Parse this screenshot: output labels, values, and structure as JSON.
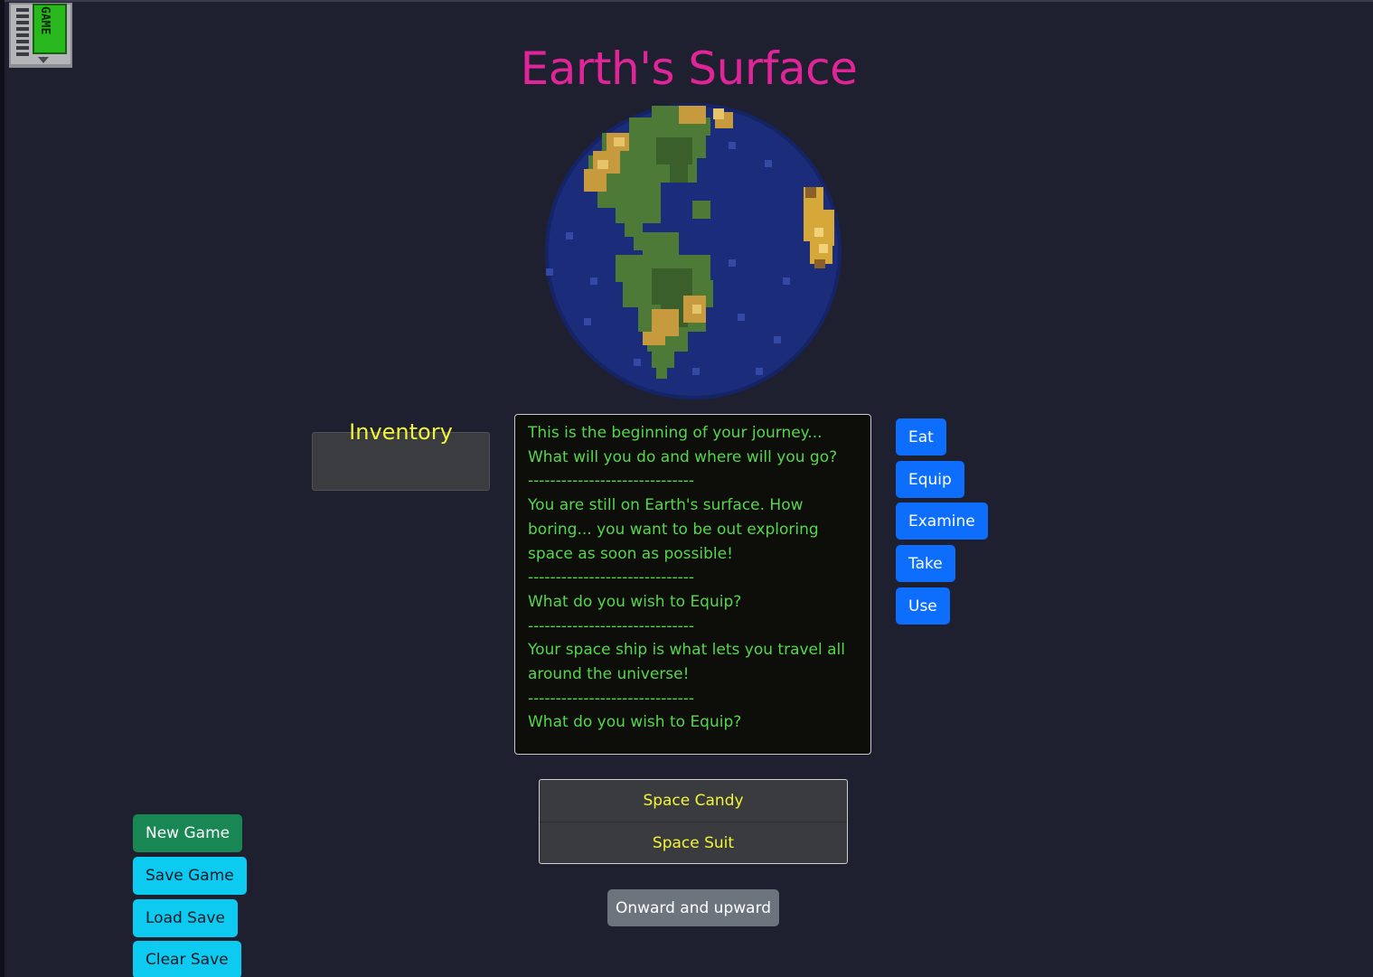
{
  "logo": {
    "icon": "game-cartridge-icon",
    "text": "GAME"
  },
  "location": {
    "title": "Earth's Surface",
    "image": "pixel-earth-globe"
  },
  "inventory": {
    "label": "Inventory",
    "items": []
  },
  "log": [
    {
      "type": "text",
      "text": "This is the beginning of your journey... What will you do and where will you go?"
    },
    {
      "type": "divider",
      "text": "------------------------------"
    },
    {
      "type": "text",
      "text": "You are still on Earth's surface. How boring... you want to be out exploring space as soon as possible!"
    },
    {
      "type": "divider",
      "text": "------------------------------"
    },
    {
      "type": "text",
      "text": "What do you wish to Equip?"
    },
    {
      "type": "divider",
      "text": "------------------------------"
    },
    {
      "type": "text",
      "text": "Your space ship is what lets you travel all around the universe!"
    },
    {
      "type": "divider",
      "text": "------------------------------"
    },
    {
      "type": "text",
      "text": "What do you wish to Equip?"
    }
  ],
  "actions": [
    "Eat",
    "Equip",
    "Examine",
    "Take",
    "Use"
  ],
  "choices": [
    "Space Candy",
    "Space Suit"
  ],
  "onward_label": "Onward and upward",
  "game_buttons": {
    "new_game": "New Game",
    "save_game": "Save Game",
    "load_save": "Load Save",
    "clear_save": "Clear Save"
  },
  "colors": {
    "background": "#1e1f2f",
    "title": "#e02598",
    "inventory_label": "#f2f43a",
    "log_text": "#56d64b",
    "action_button": "#0d6efd",
    "choice_text": "#f2f43a",
    "new_game": "#198754",
    "save_buttons": "#0dcaf0",
    "onward_button": "#6d747d"
  }
}
